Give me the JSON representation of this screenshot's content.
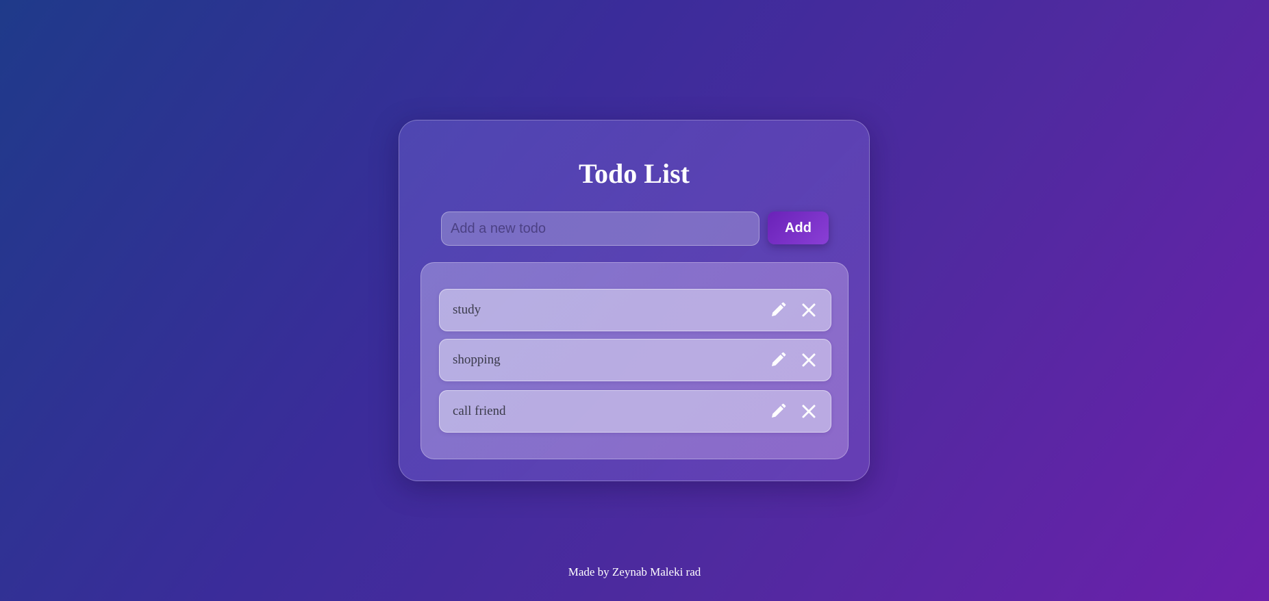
{
  "app": {
    "title": "Todo List"
  },
  "input": {
    "placeholder": "Add a new todo",
    "value": ""
  },
  "add_button": {
    "label": "Add"
  },
  "todos": [
    {
      "text": "study",
      "actions": [
        "pencil-icon",
        "close-icon"
      ]
    },
    {
      "text": "shopping",
      "actions": [
        "pencil-icon",
        "close-icon"
      ]
    },
    {
      "text": "call friend",
      "actions": [
        "pencil-icon",
        "close-icon"
      ]
    }
  ],
  "footer": {
    "text": "Made by Zeynab Maleki rad"
  },
  "colors": {
    "accent": "#7a30c8",
    "background_start": "#1f3a8a",
    "background_end": "#6c20ab",
    "text_on_dark": "#ffffff"
  }
}
